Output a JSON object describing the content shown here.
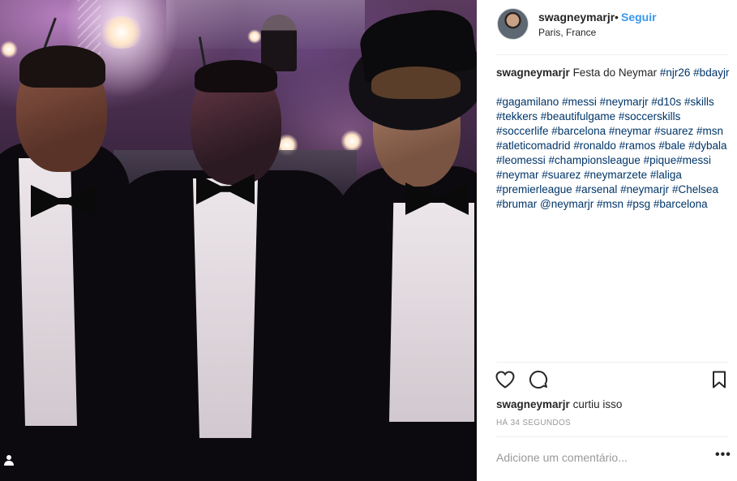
{
  "post": {
    "username": "swagneymarjr",
    "separator": "•",
    "follow_label": "Seguir",
    "location": "Paris, France",
    "caption_text": "Festa do Neymar",
    "caption_tags_line1": [
      "#njr26",
      "#bdayjr"
    ],
    "hashtags": [
      "#gagamilano",
      "#messi",
      "#neymarjr",
      "#d10s",
      "#skills",
      "#tekkers",
      "#beautifulgame",
      "#soccerskills",
      "#soccerlife",
      "#barcelona",
      "#neymar",
      "#suarez",
      "#msn",
      "#atleticomadrid",
      "#ronaldo",
      "#ramos",
      "#bale",
      "#dybala",
      "#leomessi",
      "#championsleague",
      "#pique#messi",
      "#neymar",
      "#suarez",
      "#neymarzete",
      "#laliga",
      "#premierleague",
      "#arsenal",
      "#neymarjr",
      "#Chelsea",
      "#brumar",
      "@neymarjr",
      "#msn",
      "#psg",
      "#barcelona"
    ],
    "liked_by_user": "swagneymarjr",
    "liked_suffix": "curtiu isso",
    "timestamp": "HÁ 34 SEGUNDOS",
    "comment_placeholder": "Adicione um comentário...",
    "more_label": "•••"
  },
  "icons": {
    "like": "heart-icon",
    "comment": "comment-icon",
    "save": "bookmark-icon",
    "user_tag": "user-tag-icon"
  },
  "colors": {
    "link_blue": "#3897f0",
    "hashtag": "#003569",
    "muted": "#999999",
    "text": "#262626"
  }
}
